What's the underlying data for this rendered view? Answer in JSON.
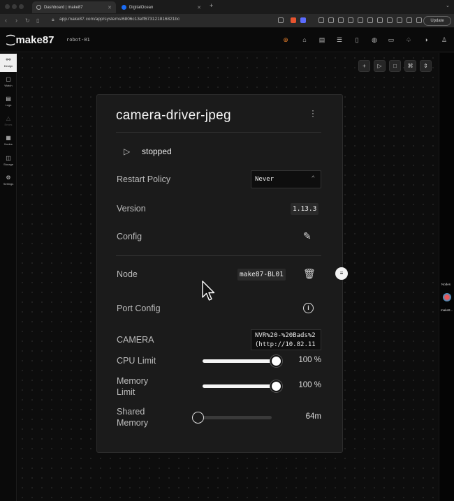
{
  "browser": {
    "tabs": [
      {
        "label": "Dashboard | make87",
        "active": true
      },
      {
        "label": "DigitalOcean",
        "active": false
      }
    ],
    "url": "app.make87.com/app/systems/6806c13eff673121816821bc",
    "update_label": "Update"
  },
  "header": {
    "logo": "make87",
    "robot_name": "robot-01"
  },
  "sidebar": {
    "items": [
      {
        "label": "Design",
        "icon": "design-icon",
        "active": true
      },
      {
        "label": "Watch",
        "icon": "watch-icon"
      },
      {
        "label": "Logs",
        "icon": "logs-icon"
      },
      {
        "label": "Errors",
        "icon": "errors-icon",
        "dim": true
      },
      {
        "label": "Nodes",
        "icon": "nodes-icon"
      },
      {
        "label": "Storage",
        "icon": "storage-icon"
      },
      {
        "label": "Settings",
        "icon": "settings-icon"
      }
    ]
  },
  "right_rail": {
    "label": "Nodes",
    "node_label": "make8..."
  },
  "card": {
    "title": "camera-driver-jpeg",
    "status": "stopped",
    "restart_policy": {
      "label": "Restart Policy",
      "value": "Never"
    },
    "version": {
      "label": "Version",
      "value": "1.13.3"
    },
    "config": {
      "label": "Config"
    },
    "node": {
      "label": "Node",
      "value": "make87-BL01"
    },
    "port_config": {
      "label": "Port Config"
    },
    "camera": {
      "label": "CAMERA",
      "value": "NVR%20-%20Bads%2\n(http://10.82.11"
    },
    "cpu_limit": {
      "label": "CPU Limit",
      "value": "100 %",
      "fraction": 1.0
    },
    "memory_limit": {
      "label": "Memory\nLimit",
      "value": "100 %",
      "fraction": 1.0
    },
    "shared_memory": {
      "label": "Shared\nMemory",
      "value": "64m",
      "fraction": 0.0
    }
  }
}
